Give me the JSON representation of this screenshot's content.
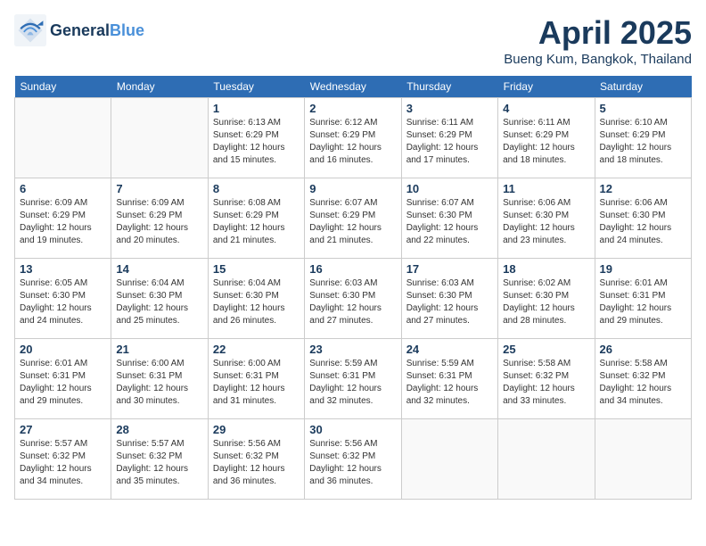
{
  "header": {
    "logo_general": "General",
    "logo_blue": "Blue",
    "title": "April 2025",
    "location": "Bueng Kum, Bangkok, Thailand"
  },
  "days_of_week": [
    "Sunday",
    "Monday",
    "Tuesday",
    "Wednesday",
    "Thursday",
    "Friday",
    "Saturday"
  ],
  "weeks": [
    [
      {
        "day": "",
        "info": ""
      },
      {
        "day": "",
        "info": ""
      },
      {
        "day": "1",
        "info": "Sunrise: 6:13 AM\nSunset: 6:29 PM\nDaylight: 12 hours and 15 minutes."
      },
      {
        "day": "2",
        "info": "Sunrise: 6:12 AM\nSunset: 6:29 PM\nDaylight: 12 hours and 16 minutes."
      },
      {
        "day": "3",
        "info": "Sunrise: 6:11 AM\nSunset: 6:29 PM\nDaylight: 12 hours and 17 minutes."
      },
      {
        "day": "4",
        "info": "Sunrise: 6:11 AM\nSunset: 6:29 PM\nDaylight: 12 hours and 18 minutes."
      },
      {
        "day": "5",
        "info": "Sunrise: 6:10 AM\nSunset: 6:29 PM\nDaylight: 12 hours and 18 minutes."
      }
    ],
    [
      {
        "day": "6",
        "info": "Sunrise: 6:09 AM\nSunset: 6:29 PM\nDaylight: 12 hours and 19 minutes."
      },
      {
        "day": "7",
        "info": "Sunrise: 6:09 AM\nSunset: 6:29 PM\nDaylight: 12 hours and 20 minutes."
      },
      {
        "day": "8",
        "info": "Sunrise: 6:08 AM\nSunset: 6:29 PM\nDaylight: 12 hours and 21 minutes."
      },
      {
        "day": "9",
        "info": "Sunrise: 6:07 AM\nSunset: 6:29 PM\nDaylight: 12 hours and 21 minutes."
      },
      {
        "day": "10",
        "info": "Sunrise: 6:07 AM\nSunset: 6:30 PM\nDaylight: 12 hours and 22 minutes."
      },
      {
        "day": "11",
        "info": "Sunrise: 6:06 AM\nSunset: 6:30 PM\nDaylight: 12 hours and 23 minutes."
      },
      {
        "day": "12",
        "info": "Sunrise: 6:06 AM\nSunset: 6:30 PM\nDaylight: 12 hours and 24 minutes."
      }
    ],
    [
      {
        "day": "13",
        "info": "Sunrise: 6:05 AM\nSunset: 6:30 PM\nDaylight: 12 hours and 24 minutes."
      },
      {
        "day": "14",
        "info": "Sunrise: 6:04 AM\nSunset: 6:30 PM\nDaylight: 12 hours and 25 minutes."
      },
      {
        "day": "15",
        "info": "Sunrise: 6:04 AM\nSunset: 6:30 PM\nDaylight: 12 hours and 26 minutes."
      },
      {
        "day": "16",
        "info": "Sunrise: 6:03 AM\nSunset: 6:30 PM\nDaylight: 12 hours and 27 minutes."
      },
      {
        "day": "17",
        "info": "Sunrise: 6:03 AM\nSunset: 6:30 PM\nDaylight: 12 hours and 27 minutes."
      },
      {
        "day": "18",
        "info": "Sunrise: 6:02 AM\nSunset: 6:30 PM\nDaylight: 12 hours and 28 minutes."
      },
      {
        "day": "19",
        "info": "Sunrise: 6:01 AM\nSunset: 6:31 PM\nDaylight: 12 hours and 29 minutes."
      }
    ],
    [
      {
        "day": "20",
        "info": "Sunrise: 6:01 AM\nSunset: 6:31 PM\nDaylight: 12 hours and 29 minutes."
      },
      {
        "day": "21",
        "info": "Sunrise: 6:00 AM\nSunset: 6:31 PM\nDaylight: 12 hours and 30 minutes."
      },
      {
        "day": "22",
        "info": "Sunrise: 6:00 AM\nSunset: 6:31 PM\nDaylight: 12 hours and 31 minutes."
      },
      {
        "day": "23",
        "info": "Sunrise: 5:59 AM\nSunset: 6:31 PM\nDaylight: 12 hours and 32 minutes."
      },
      {
        "day": "24",
        "info": "Sunrise: 5:59 AM\nSunset: 6:31 PM\nDaylight: 12 hours and 32 minutes."
      },
      {
        "day": "25",
        "info": "Sunrise: 5:58 AM\nSunset: 6:32 PM\nDaylight: 12 hours and 33 minutes."
      },
      {
        "day": "26",
        "info": "Sunrise: 5:58 AM\nSunset: 6:32 PM\nDaylight: 12 hours and 34 minutes."
      }
    ],
    [
      {
        "day": "27",
        "info": "Sunrise: 5:57 AM\nSunset: 6:32 PM\nDaylight: 12 hours and 34 minutes."
      },
      {
        "day": "28",
        "info": "Sunrise: 5:57 AM\nSunset: 6:32 PM\nDaylight: 12 hours and 35 minutes."
      },
      {
        "day": "29",
        "info": "Sunrise: 5:56 AM\nSunset: 6:32 PM\nDaylight: 12 hours and 36 minutes."
      },
      {
        "day": "30",
        "info": "Sunrise: 5:56 AM\nSunset: 6:32 PM\nDaylight: 12 hours and 36 minutes."
      },
      {
        "day": "",
        "info": ""
      },
      {
        "day": "",
        "info": ""
      },
      {
        "day": "",
        "info": ""
      }
    ]
  ]
}
